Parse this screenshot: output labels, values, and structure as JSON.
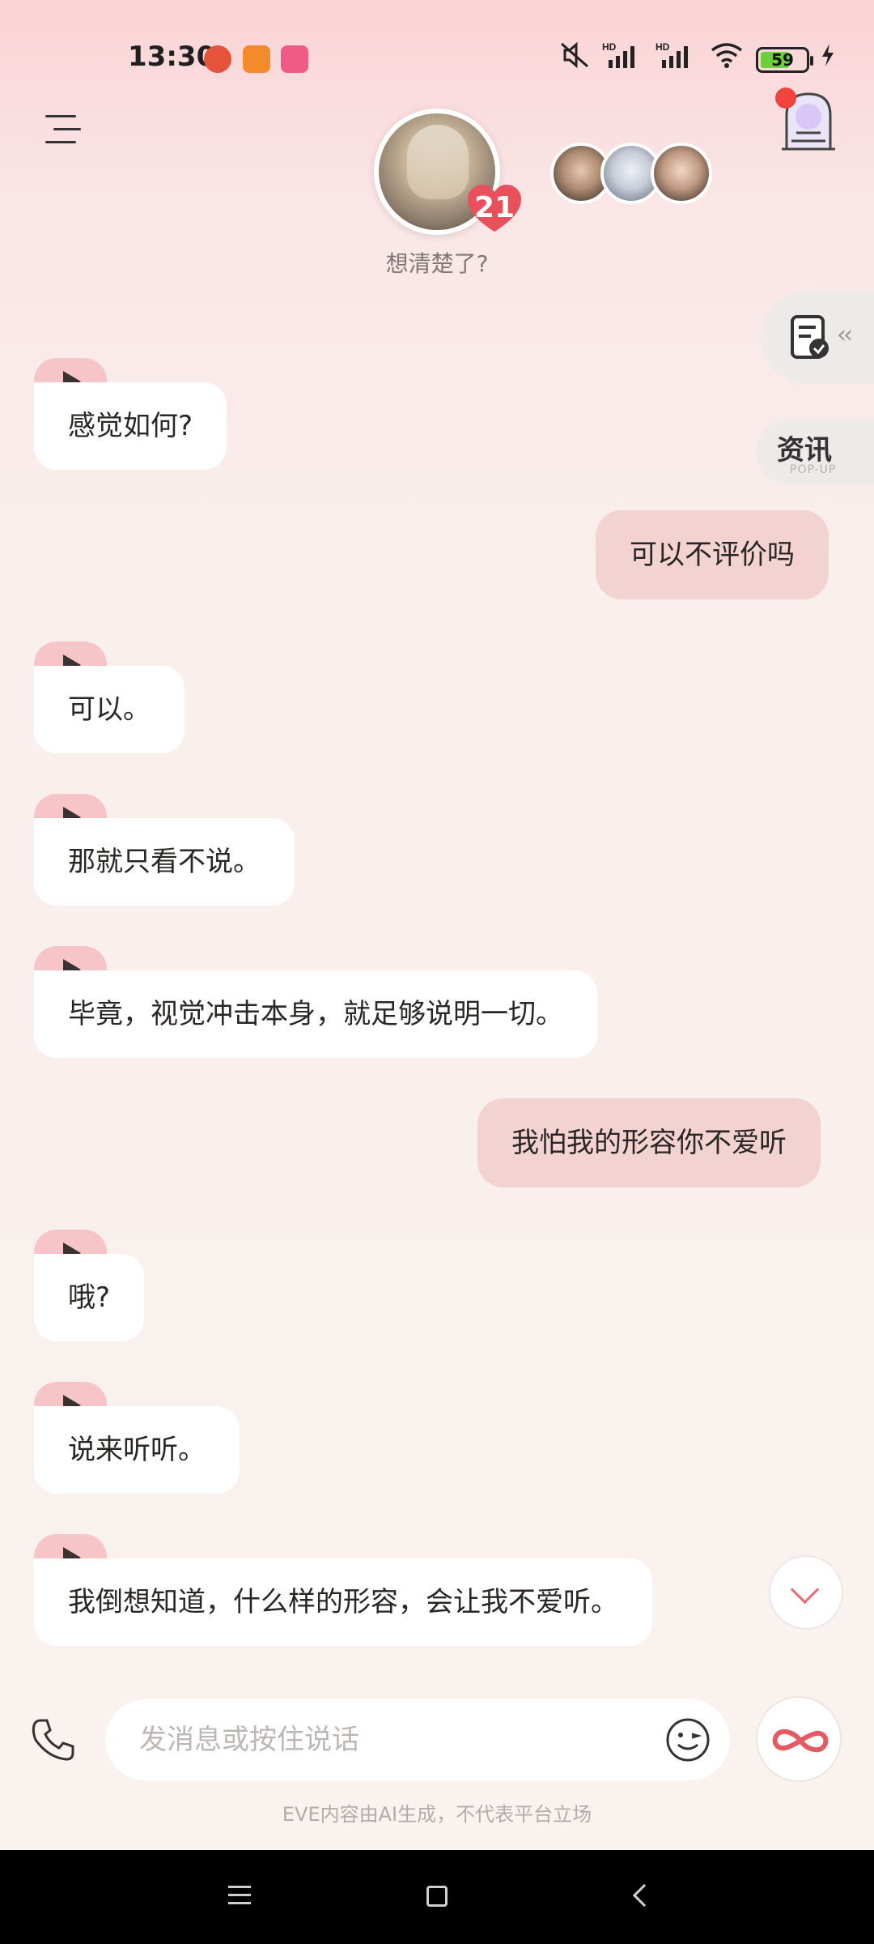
{
  "status_bar": {
    "time": "13:30",
    "app_icons": [
      "tomato-app-icon",
      "shopping-app-icon",
      "bilibili-app-icon"
    ],
    "network_1": "HD",
    "network_2": "HD",
    "battery": "59"
  },
  "header": {
    "menu_icon": "menu-icon",
    "character_avatar": "character-avatar",
    "affinity_count": "21",
    "subtitle": "想清楚了?",
    "other_characters": [
      "character-avatar-1",
      "character-avatar-2",
      "character-avatar-3"
    ],
    "portal_icon": "portal-door-icon"
  },
  "side": {
    "task_icon": "task-list-icon",
    "news_label": "资讯",
    "news_sub": "POP-UP"
  },
  "messages": [
    {
      "role": "ai",
      "text": "感觉如何?"
    },
    {
      "role": "user",
      "text": "可以不评价吗"
    },
    {
      "role": "ai",
      "text": "可以。"
    },
    {
      "role": "ai",
      "text": "那就只看不说。"
    },
    {
      "role": "ai",
      "text": "毕竟，视觉冲击本身，就足够说明一切。"
    },
    {
      "role": "user",
      "text": "我怕我的形容你不爱听"
    },
    {
      "role": "ai",
      "text": "哦?"
    },
    {
      "role": "ai",
      "text": "说来听听。"
    },
    {
      "role": "ai",
      "text": "我倒想知道，什么样的形容，会让我不爱听。"
    }
  ],
  "input": {
    "placeholder": "发消息或按住说话",
    "phone_icon": "phone-icon",
    "emoji_icon": "emoji-icon",
    "infinity_icon": "infinity-icon"
  },
  "disclaimer": "EVE内容由AI生成，不代表平台立场",
  "colors": {
    "accent": "#e8505b",
    "user_bubble": "#f2d3d1",
    "ai_bubble": "#ffffff",
    "play_tab": "#f7c5c8"
  }
}
